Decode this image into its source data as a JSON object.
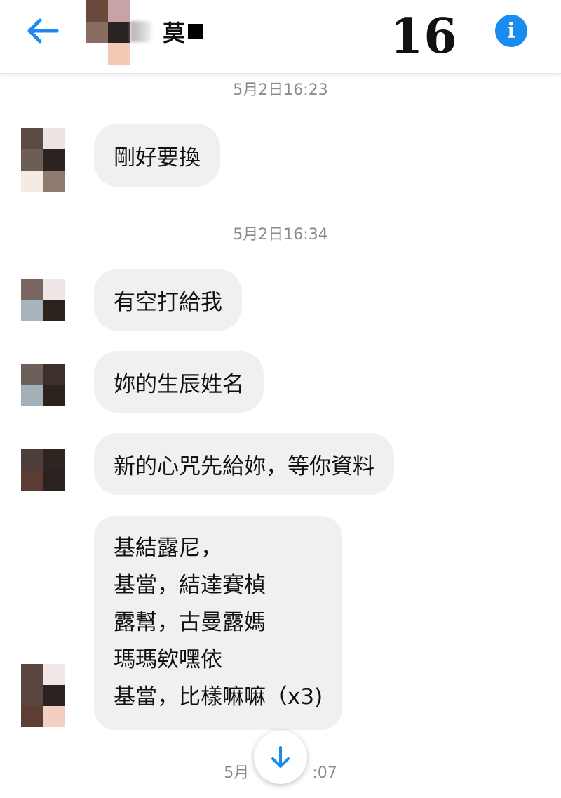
{
  "header": {
    "back_icon": "arrow-left-icon",
    "contact_name": "莫",
    "counter": "16",
    "info_icon": "info-icon",
    "info_glyph": "i",
    "accent_color": "#1a8cf0"
  },
  "messages": [
    {
      "timestamp": "5月2日16:23",
      "text": "剛好要換"
    },
    {
      "timestamp": "5月2日16:34",
      "text": "有空打給我"
    },
    {
      "text": "妳的生辰姓名"
    },
    {
      "text": "新的心咒先給妳，等你資料"
    },
    {
      "lines": [
        "基結露尼，",
        "基當，結達賽楨",
        "露幫，古曼露媽",
        "瑪瑪欸嘿依",
        "基當，比樣嘛嘛（x3)"
      ]
    }
  ],
  "bottom_timestamp": {
    "left": "5月",
    "right": ":07"
  },
  "scroll_down_icon": "arrow-down-icon"
}
